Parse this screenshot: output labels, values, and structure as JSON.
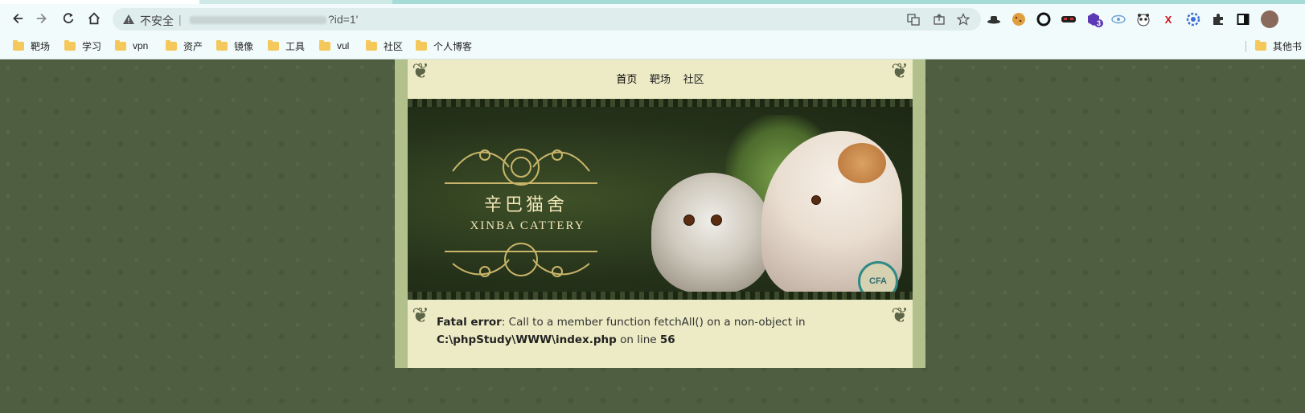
{
  "browser": {
    "address": {
      "security_label": "不安全",
      "separator": "|",
      "url_visible_suffix": "?id=1'"
    },
    "extensions": [
      {
        "icon": "hat-icon"
      },
      {
        "icon": "cookie-icon"
      },
      {
        "icon": "ring-icon"
      },
      {
        "icon": "mask-icon"
      },
      {
        "icon": "hexagon-badge-icon",
        "badge": "3"
      },
      {
        "icon": "eye-icon"
      },
      {
        "icon": "panda-icon"
      },
      {
        "icon": "x-icon"
      },
      {
        "icon": "gear-blue-icon"
      },
      {
        "icon": "puzzle-icon"
      },
      {
        "icon": "sidepanel-icon"
      },
      {
        "icon": "avatar-icon"
      }
    ],
    "bookmarks": [
      {
        "label": "靶场"
      },
      {
        "label": "学习"
      },
      {
        "label": "vpn"
      },
      {
        "label": "资产"
      },
      {
        "label": "镜像"
      },
      {
        "label": "工具"
      },
      {
        "label": "vul"
      },
      {
        "label": "社区"
      },
      {
        "label": "个人博客"
      }
    ],
    "other_bookmarks": "其他书"
  },
  "site": {
    "nav": [
      {
        "label": "首页"
      },
      {
        "label": "靶场"
      },
      {
        "label": "社区"
      }
    ],
    "banner": {
      "title_cn": "辛巴猫舍",
      "title_en": "XINBA CATTERY",
      "badge_text": "CFA"
    },
    "error": {
      "label": "Fatal error",
      "message": ": Call to a member function fetchAll() on a non-object in",
      "file": "C:\\phpStudy\\WWW\\index.php",
      "on_line_text": " on line ",
      "line": "56"
    }
  },
  "colors": {
    "page_bg": "#4f5d40",
    "panel_bg": "#ecebc5",
    "frame": "#b2c08c"
  }
}
